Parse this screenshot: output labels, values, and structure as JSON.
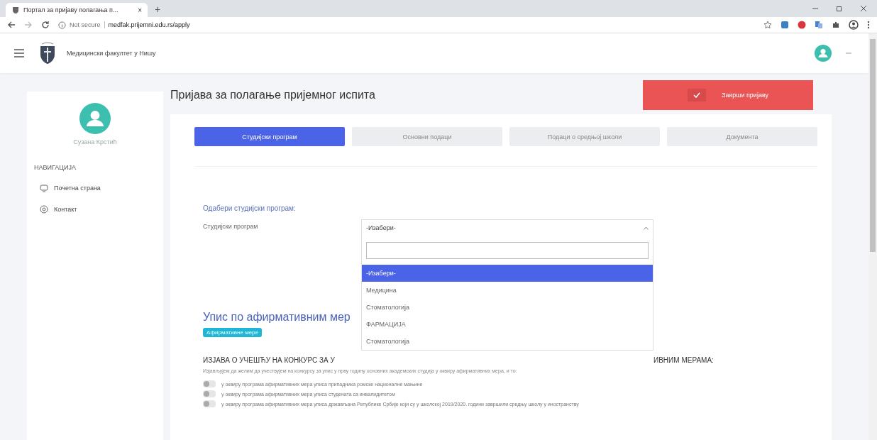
{
  "browser": {
    "tab_title": "Портал за пријаву полагања п...",
    "tab_close": "×",
    "new_tab": "+",
    "address_prefix": "Not secure",
    "address": "medfak.prijemni.edu.rs/apply"
  },
  "header": {
    "title": "Медицински факултет у Нишу"
  },
  "sidebar": {
    "user_name": "Сузана Крстић",
    "section": "НАВИГАЦИЈА",
    "items": [
      {
        "label": "Почетна страна",
        "kind": "home"
      },
      {
        "label": "Контакт",
        "kind": "contact"
      }
    ]
  },
  "page_title": "Пријава за полагање пријемног испита",
  "finish_button": "Заврши пријаву",
  "tabs": [
    {
      "label": "Студијски програм",
      "selected": true
    },
    {
      "label": "Основни подаци",
      "selected": false
    },
    {
      "label": "Подаци о средњој школи",
      "selected": false
    },
    {
      "label": "Документа",
      "selected": false
    }
  ],
  "program": {
    "heading": "Одабери студијски програм:",
    "label": "Студијски програм",
    "value": "-Изабери-",
    "options": [
      {
        "label": "-Изабери-",
        "selected": true
      },
      {
        "label": "Медицина",
        "selected": false
      },
      {
        "label": "Стоматологија",
        "selected": false
      },
      {
        "label": "ФАРМАЦИЈА",
        "selected": false
      },
      {
        "label": "Стоматологија",
        "selected": false
      }
    ]
  },
  "affirmative": {
    "heading": "Упис по афирмативним мер",
    "badge": "Афирмативне мере",
    "statement_start": "ИЗЈАВА О УЧЕШЋУ НА КОНКУРС ЗА У",
    "statement_end": "ИВНИМ МЕРАМА:",
    "intro": "Изјављујем да желим да учествујем на конкурсу за упис у прву годину основних академских студија у оквиру афирмативних мера, и то:",
    "options": [
      {
        "label": "у оквиру програма афирмативних мера уписа припадника ромске националне мањине",
        "checked": false
      },
      {
        "label": "у оквиру програма афирмативних мера уписа студената са инвалидитетом",
        "checked": false
      },
      {
        "label": "у оквиру програма афирмативних мера уписа држављана Републике Србије који су у школској 2019/2020. години завршили средњу школу у иностранству",
        "checked": false
      }
    ]
  }
}
